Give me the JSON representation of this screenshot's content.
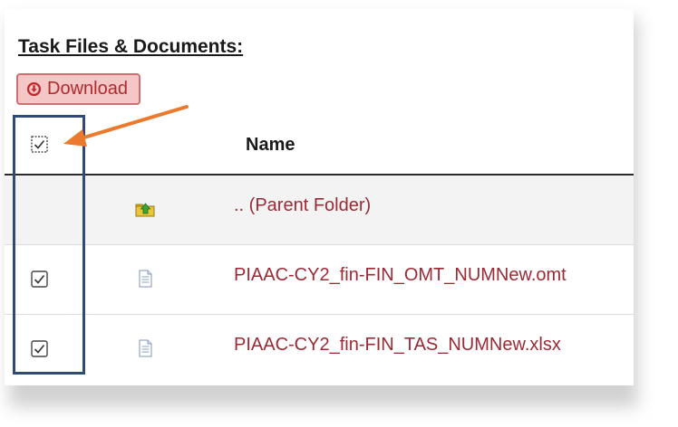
{
  "section": {
    "title": "Task Files & Documents:"
  },
  "toolbar": {
    "download_label": "Download",
    "download_icon": "download-circle-icon"
  },
  "table": {
    "columns": [
      "",
      "",
      "Name"
    ],
    "select_all_checked": true,
    "rows": [
      {
        "name": ".. (Parent Folder)",
        "icon": "parent-folder-icon",
        "checkable": false,
        "checked": false
      },
      {
        "name": "PIAAC-CY2_fin-FIN_OMT_NUMNew.omt",
        "icon": "document-icon",
        "checkable": true,
        "checked": true
      },
      {
        "name": "PIAAC-CY2_fin-FIN_TAS_NUMNew.xlsx",
        "icon": "document-icon",
        "checkable": true,
        "checked": true
      }
    ]
  },
  "colors": {
    "link": "#9b2a35",
    "button_bg": "#f4c6c6",
    "button_border": "#cf6f72",
    "button_text": "#b02a2e",
    "highlight_box": "#2f4a7a",
    "arrow": "#ec7a2d"
  }
}
